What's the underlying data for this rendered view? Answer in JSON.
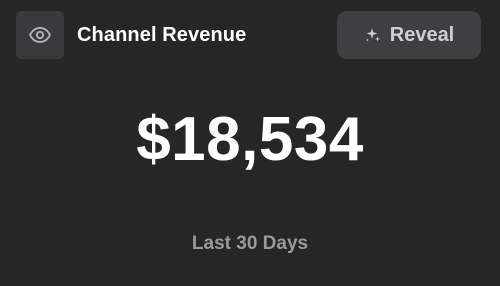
{
  "header": {
    "title": "Channel Revenue",
    "visibility_icon": "eye-icon",
    "reveal_button": {
      "label": "Reveal",
      "icon": "sparkles-icon"
    }
  },
  "metric": {
    "value": "$18,534",
    "period": "Last 30 Days"
  },
  "colors": {
    "background": "#262626",
    "icon_box": "#3a3a3c",
    "button": "#3f3f42",
    "text_primary": "#ffffff",
    "text_muted": "#9a9a9d"
  }
}
